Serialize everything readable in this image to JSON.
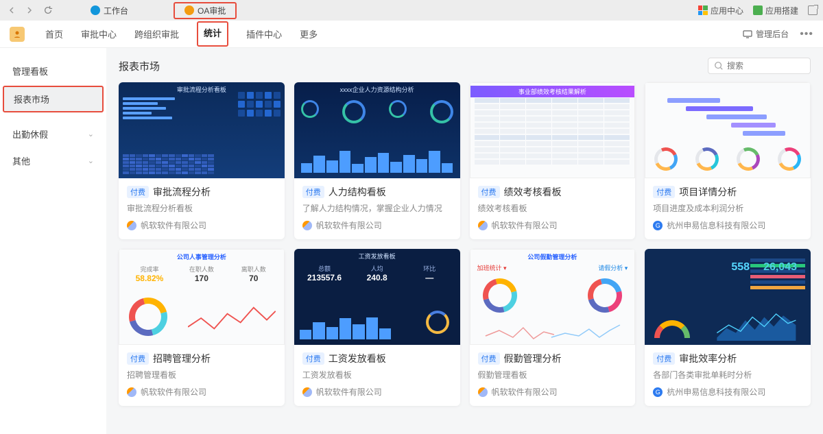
{
  "topbar": {
    "tabs": [
      {
        "label": "工作台"
      },
      {
        "label": "OA审批"
      }
    ],
    "right": {
      "app_center": "应用中心",
      "app_build": "应用搭建"
    }
  },
  "nav": {
    "links": [
      "首页",
      "审批中心",
      "跨组织审批",
      "统计",
      "插件中心",
      "更多"
    ],
    "active": "统计",
    "admin": "管理后台"
  },
  "sidebar": {
    "items": [
      {
        "label": "管理看板",
        "expandable": false
      },
      {
        "label": "报表市场",
        "expandable": false,
        "active": true
      },
      {
        "label": "出勤休假",
        "expandable": true
      },
      {
        "label": "其他",
        "expandable": true
      }
    ]
  },
  "content": {
    "title": "报表市场",
    "search_placeholder": "搜索",
    "badge": "付费",
    "cards": [
      {
        "title": "审批流程分析",
        "sub": "审批流程分析看板",
        "vendor": "帆软软件有限公司",
        "vtype": "fr",
        "thumb_title": "审批流程分析看板"
      },
      {
        "title": "人力结构看板",
        "sub": "了解人力结构情况，掌握企业人力情况",
        "vendor": "帆软软件有限公司",
        "vtype": "fr",
        "thumb_title": "xxxx企业人力资源结构分析"
      },
      {
        "title": "绩效考核看板",
        "sub": "绩效考核看板",
        "vendor": "帆软软件有限公司",
        "vtype": "fr",
        "thumb_title": "事业部绩效考核结果解析"
      },
      {
        "title": "项目详情分析",
        "sub": "项目进度及成本利润分析",
        "vendor": "杭州申易信息科技有限公司",
        "vtype": "se",
        "thumb_title": ""
      },
      {
        "title": "招聘管理分析",
        "sub": "招聘管理看板",
        "vendor": "帆软软件有限公司",
        "vtype": "fr",
        "thumb_title": "公司人事管理分析",
        "kpi": {
          "pct": "58.82%",
          "v1": "170",
          "v2": "70"
        }
      },
      {
        "title": "工资发放看板",
        "sub": "工资发放看板",
        "vendor": "帆软软件有限公司",
        "vtype": "fr",
        "thumb_title": "工资发放看板",
        "kpi": {
          "v1": "213557.6",
          "v2": "240.8"
        }
      },
      {
        "title": "假勤管理分析",
        "sub": "假勤管理看板",
        "vendor": "帆软软件有限公司",
        "vtype": "fr",
        "thumb_title": "公司假勤管理分析"
      },
      {
        "title": "审批效率分析",
        "sub": "各部门各类审批单耗时分析",
        "vendor": "杭州申易信息科技有限公司",
        "vtype": "se",
        "thumb_title": "",
        "kpi": {
          "v1": "558",
          "v2": "26,043"
        }
      }
    ]
  }
}
